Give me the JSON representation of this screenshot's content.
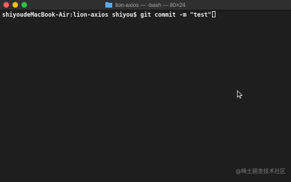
{
  "window": {
    "title": "lion-axios — -bash — 80×24"
  },
  "terminal": {
    "prompt": "shiyoudeMacBook-Air:lion-axios shiyou$ ",
    "command": "git commit -m \"test\""
  },
  "watermark": {
    "text": "@稀土掘金技术社区"
  },
  "icons": [
    "close-icon",
    "minimize-icon",
    "maximize-icon",
    "folder-icon",
    "mouse-pointer-icon"
  ],
  "colors": {
    "close": "#ff5f57",
    "minimize": "#febc2e",
    "maximize": "#28c840",
    "folder": "#5aa9e6",
    "background": "#1e1e1e",
    "text": "#ececec"
  }
}
